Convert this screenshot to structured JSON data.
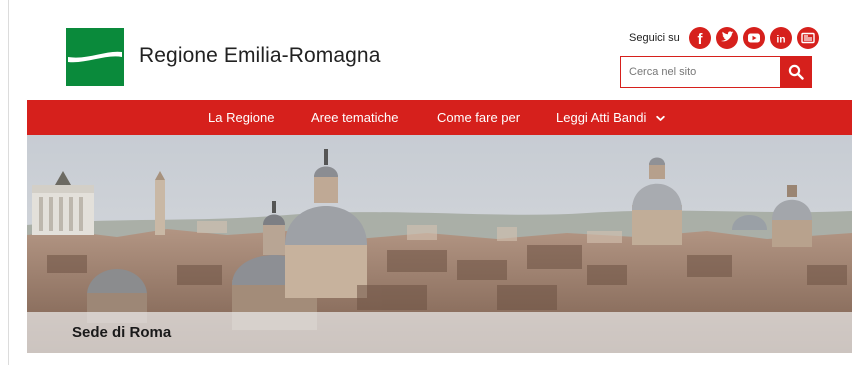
{
  "header": {
    "site_title": "Regione Emilia-Romagna",
    "follow_label": "Seguici su",
    "social": [
      {
        "name": "facebook-icon",
        "glyph": "f"
      },
      {
        "name": "twitter-icon",
        "glyph": ""
      },
      {
        "name": "youtube-icon",
        "glyph": ""
      },
      {
        "name": "linkedin-icon",
        "glyph": "in"
      },
      {
        "name": "news-icon",
        "glyph": ""
      }
    ],
    "search": {
      "placeholder": "Cerca nel sito"
    }
  },
  "nav": {
    "items": [
      {
        "label": "La Regione"
      },
      {
        "label": "Aree tematiche"
      },
      {
        "label": "Come fare per"
      },
      {
        "label": "Leggi Atti Bandi"
      }
    ]
  },
  "hero": {
    "caption": "Sede di Roma"
  },
  "colors": {
    "brand_red": "#d6201c",
    "brand_green": "#0a8a3b"
  }
}
